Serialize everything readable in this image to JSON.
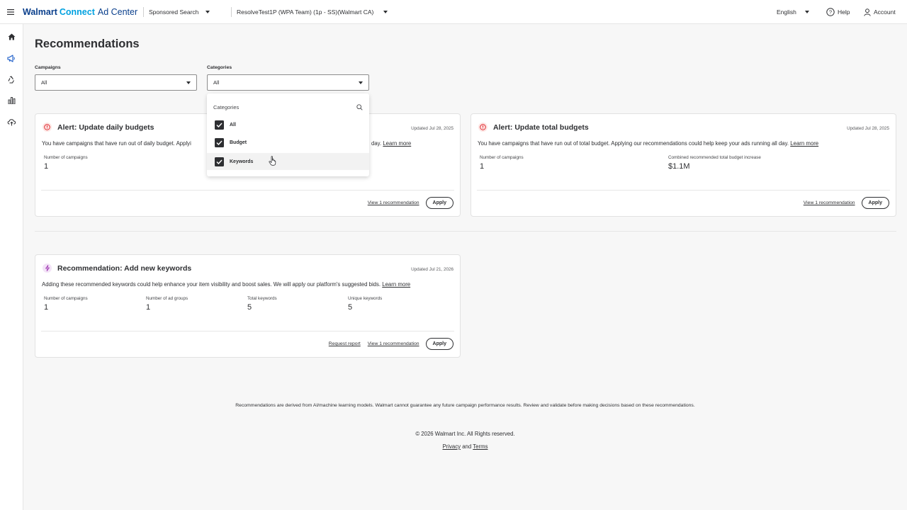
{
  "header": {
    "brand_part1": "Walmart",
    "brand_part2": "Connect",
    "brand_part3": "Ad Center",
    "product_selector": "Sponsored Search",
    "account_selector": "ResolveTest1P (WPA Team) (1p - SS)(Walmart CA)",
    "language": "English",
    "help": "Help",
    "account": "Account"
  },
  "rail": {
    "icons": [
      "home-icon",
      "megaphone-icon",
      "recycle-icon",
      "bar-chart-icon",
      "cloud-upload-icon"
    ],
    "active_index": 1
  },
  "page": {
    "title": "Recommendations",
    "filters": {
      "campaigns_label": "Campaigns",
      "campaigns_value": "All",
      "categories_label": "Categories",
      "categories_value": "All"
    }
  },
  "dropdown": {
    "search_placeholder": "Categories",
    "options": [
      {
        "label": "All",
        "checked": true
      },
      {
        "label": "Budget",
        "checked": true
      },
      {
        "label": "Keywords",
        "checked": true
      }
    ]
  },
  "cards": {
    "daily": {
      "title": "Alert: Update daily budgets",
      "updated": "Updated Jul 28, 2025",
      "desc_visible": "You have campaigns that have run out of daily budget. Applyi",
      "desc_tail": "day.",
      "learn_more": "Learn more",
      "metric_label": "Number of campaigns",
      "metric_value": "1",
      "view_link": "View 1 recommendation",
      "apply": "Apply"
    },
    "total": {
      "title": "Alert: Update total budgets",
      "updated": "Updated Jul 28, 2025",
      "desc": "You have campaigns that have run out of total budget. Applying our recommendations could help keep your ads running all day.",
      "learn_more": "Learn more",
      "metric1_label": "Number of campaigns",
      "metric1_value": "1",
      "metric2_label": "Combined recommended total budget increase",
      "metric2_value": "$1.1M",
      "view_link": "View 1 recommendation",
      "apply": "Apply"
    },
    "keywords": {
      "title": "Recommendation: Add new keywords",
      "updated": "Updated Jul 21, 2026",
      "desc": "Adding these recommended keywords could help enhance your item visibility and boost sales. We will apply our platform's suggested bids.",
      "learn_more": "Learn more",
      "metrics": [
        {
          "label": "Number of campaigns",
          "value": "1"
        },
        {
          "label": "Number of ad groups",
          "value": "1"
        },
        {
          "label": "Total keywords",
          "value": "5"
        },
        {
          "label": "Unique keywords",
          "value": "5"
        }
      ],
      "request_report": "Request report",
      "view_link": "View 1 recommendation",
      "apply": "Apply"
    }
  },
  "footer": {
    "note": "Recommendations are derived from AI/machine learning models. Walmart cannot guarantee any future campaign performance results. Review and validate before making decisions based on these recommendations.",
    "copyright": "© 2026 Walmart Inc. All Rights reserved.",
    "privacy": "Privacy",
    "and": "and",
    "terms": "Terms"
  },
  "colors": {
    "brand_dark": "#0a3f8c",
    "brand_light": "#00a1e0",
    "alert_red": "#de1c24",
    "rec_purple": "#9b2fae"
  }
}
